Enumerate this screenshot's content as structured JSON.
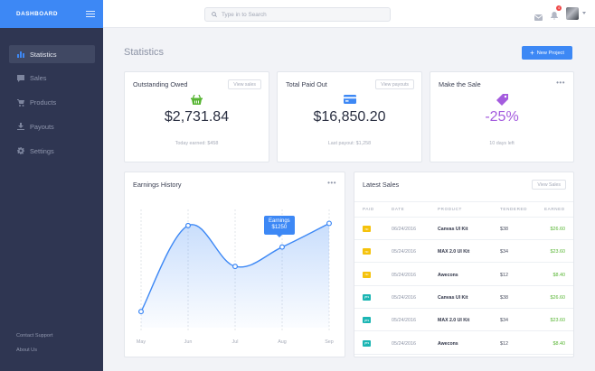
{
  "brand": {
    "title": "DASHBOARD"
  },
  "sidebar": {
    "items": [
      {
        "label": "Statistics",
        "icon": "bar-chart-icon"
      },
      {
        "label": "Sales",
        "icon": "chat-icon"
      },
      {
        "label": "Products",
        "icon": "cart-icon"
      },
      {
        "label": "Payouts",
        "icon": "download-icon"
      },
      {
        "label": "Settings",
        "icon": "gear-icon"
      }
    ],
    "active_index": 0,
    "footer": {
      "contact": "Contact Support",
      "about": "About Us"
    }
  },
  "topbar": {
    "search_placeholder": "Type in to Search",
    "notification_count": "4"
  },
  "page": {
    "title": "Statistics",
    "new_project_label": "New Project"
  },
  "cards": {
    "owed": {
      "title": "Outstanding Owed",
      "button": "View sales",
      "value": "$2,731.84",
      "sub": "Today earned: $458",
      "icon_color": "#57b533"
    },
    "paid": {
      "title": "Total Paid Out",
      "button": "View payouts",
      "value": "$16,850.20",
      "sub": "Last payout: $1,258",
      "icon_color": "#3d88f5"
    },
    "sale": {
      "title": "Make the Sale",
      "value": "-25%",
      "sub": "10 days left",
      "icon_color": "#a45cde"
    }
  },
  "earnings": {
    "title": "Earnings History",
    "tooltip": {
      "label": "Earnings",
      "value": "$1250"
    },
    "chart_data": {
      "type": "area",
      "x": [
        "May",
        "Jun",
        "Jul",
        "Aug",
        "Sep"
      ],
      "points": [
        [
          0,
          15
        ],
        [
          1,
          95
        ],
        [
          2,
          57
        ],
        [
          3,
          75
        ],
        [
          4,
          97
        ]
      ],
      "ylim": [
        0,
        110
      ],
      "highlight_index": 3,
      "grid": "vertical-dashed"
    }
  },
  "latest_sales": {
    "title": "Latest Sales",
    "button": "View Sales",
    "columns": [
      "PAID",
      "DATE",
      "PRODUCT",
      "TENDERED",
      "EARNED"
    ],
    "rows": [
      {
        "paid": "no",
        "paid_color": "#f5c20b",
        "date": "06/24/2016",
        "product": "Canvas UI Kit",
        "tendered": "$38",
        "earned": "$26.60"
      },
      {
        "paid": "no",
        "paid_color": "#f5c20b",
        "date": "05/24/2016",
        "product": "MAX 2.0 UI Kit",
        "tendered": "$34",
        "earned": "$23.60"
      },
      {
        "paid": "no",
        "paid_color": "#f5c20b",
        "date": "05/24/2016",
        "product": "Awecons",
        "tendered": "$12",
        "earned": "$8.40"
      },
      {
        "paid": "yes",
        "paid_color": "#1bb5b3",
        "date": "05/24/2016",
        "product": "Canvas UI Kit",
        "tendered": "$38",
        "earned": "$26.60"
      },
      {
        "paid": "yes",
        "paid_color": "#1bb5b3",
        "date": "05/24/2016",
        "product": "MAX 2.0 UI Kit",
        "tendered": "$34",
        "earned": "$23.60"
      },
      {
        "paid": "yes",
        "paid_color": "#1bb5b3",
        "date": "05/24/2016",
        "product": "Awecons",
        "tendered": "$12",
        "earned": "$8.40"
      }
    ]
  },
  "colors": {
    "accent": "#3d88f5",
    "sidebar": "#2f3652",
    "positive": "#57b533"
  }
}
